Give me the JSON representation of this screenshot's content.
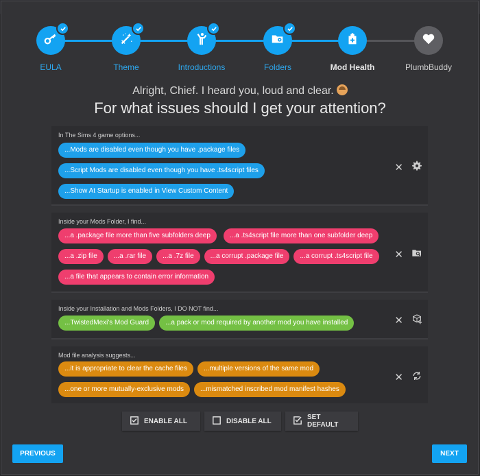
{
  "steps": [
    {
      "label": "EULA",
      "icon": "key-icon",
      "done": true
    },
    {
      "label": "Theme",
      "icon": "magic-wand-icon",
      "done": true
    },
    {
      "label": "Introductions",
      "icon": "person-waving-icon",
      "done": true
    },
    {
      "label": "Folders",
      "icon": "folder-location-icon",
      "done": true
    },
    {
      "label": "Mod Health",
      "icon": "medical-clipboard-icon",
      "done": false
    },
    {
      "label": "PlumbBuddy",
      "icon": "heart-icon",
      "done": false
    }
  ],
  "intro": "Alright, Chief. I heard you, loud and clear.",
  "question": "For what issues should I get your attention?",
  "sections": [
    {
      "title": "In The Sims 4 game options...",
      "action_icon": "gear-icon",
      "chips": [
        [
          "...Mods are disabled even though you have .package files"
        ],
        [
          "...Script Mods are disabled even though you have .ts4script files"
        ],
        [
          "...Show At Startup is enabled in View Custom Content"
        ]
      ]
    },
    {
      "title": "Inside your Mods Folder, I find...",
      "action_icon": "folder-search-icon",
      "chips": [
        [
          "...a .package file more than five subfolders deep",
          "...a .ts4script file more than one subfolder deep"
        ],
        [
          "...a .zip file",
          "...a .rar file",
          "...a .7z file",
          "...a corrupt .package file",
          "...a corrupt .ts4script file"
        ],
        [
          "...a file that appears to contain error information"
        ]
      ]
    },
    {
      "title": "Inside your Installation and Mods Folders, I DO NOT find...",
      "action_icon": "package-add-icon",
      "chips": [
        [
          "...TwistedMexi's Mod Guard",
          "...a pack or mod required by another mod you have installed"
        ]
      ]
    },
    {
      "title": "Mod file analysis suggests...",
      "action_icon": "sync-icon",
      "chips": [
        [
          "...it is appropriate to clear the cache files",
          "...multiple versions of the same mod"
        ],
        [
          "...one or more mutually-exclusive mods",
          "...mismatched inscribed mod manifest hashes"
        ]
      ]
    }
  ],
  "actions": {
    "enable_all": "ENABLE ALL",
    "disable_all": "DISABLE ALL",
    "set_default": "SET DEFAULT"
  },
  "nav": {
    "previous": "PREVIOUS",
    "next": "NEXT"
  },
  "colors": {
    "accent": "#13a3f2",
    "blue_chip": "#1ea0ea",
    "pink_chip": "#ef3e6e",
    "green_chip": "#74c044",
    "orange_chip": "#db8a10"
  }
}
